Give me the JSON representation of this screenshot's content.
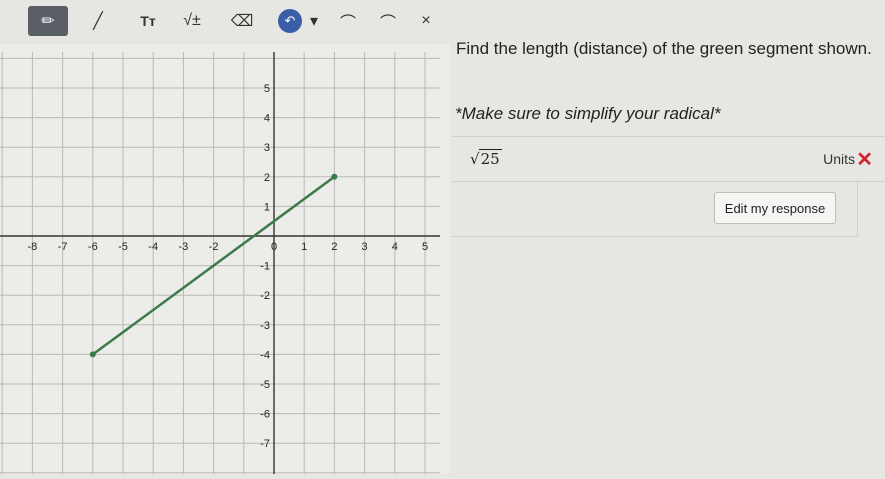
{
  "toolbar": {
    "tools": [
      {
        "name": "pencil-tool",
        "icon": "pencil-icon",
        "glyph": "✎"
      },
      {
        "name": "line-tool",
        "icon": "line-icon",
        "glyph": "╱"
      },
      {
        "name": "text-tool",
        "icon": "text-icon",
        "glyph": "Tт"
      },
      {
        "name": "math-tool",
        "icon": "sqrt-icon",
        "glyph": "√±"
      },
      {
        "name": "eraser-tool",
        "icon": "eraser-icon",
        "glyph": "⌫"
      },
      {
        "name": "undo-tool",
        "icon": "undo-icon",
        "glyph": "↶"
      },
      {
        "name": "close-tool",
        "icon": "close-icon",
        "glyph": "×"
      }
    ]
  },
  "question": {
    "text": "Find the length (distance) of the green segment shown.",
    "note": "*Make sure to simplify your radical*"
  },
  "answer": {
    "radical_symbol": "√",
    "radicand": "25",
    "units_label": "Units",
    "status": "incorrect",
    "status_color": "#d2232a"
  },
  "edit_button_label": "Edit my response",
  "graph": {
    "x_ticks": [
      -8,
      -7,
      -6,
      -5,
      -4,
      -3,
      -2,
      0,
      1,
      2,
      3,
      4,
      5
    ],
    "y_ticks": [
      5,
      4,
      3,
      2,
      1,
      -1,
      -2,
      -3,
      -4,
      -5,
      -6,
      -7
    ],
    "segment": {
      "from": [
        -6,
        -4
      ],
      "to": [
        2,
        2
      ],
      "color": "#3c7a4a"
    }
  }
}
